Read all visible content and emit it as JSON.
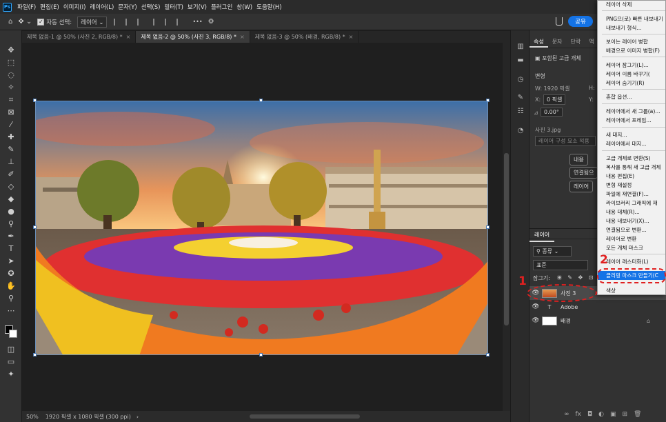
{
  "menubar": {
    "logo": "Ps",
    "items": [
      "파일(F)",
      "편집(E)",
      "이미지(I)",
      "레이어(L)",
      "문자(Y)",
      "선택(S)",
      "필터(T)",
      "보기(V)",
      "플러그인",
      "창(W)",
      "도움말(H)"
    ]
  },
  "options": {
    "auto_select_label": "자동 선택:",
    "auto_select_value": "레이어",
    "more": "•••",
    "share": "공유"
  },
  "tabs": [
    {
      "label": "제목 없음-1 @ 50% (사진 2, RGB/8) *",
      "active": false
    },
    {
      "label": "제목 없음-2 @ 50% (사진 3, RGB/8) *",
      "active": true
    },
    {
      "label": "제목 없음-3 @ 50% (배경, RGB/8) *",
      "active": false
    }
  ],
  "tab_close": "×",
  "status": {
    "zoom": "50%",
    "info": "1920 픽셀 x 1080 픽셀 (300 ppi)",
    "arrow": "›"
  },
  "properties": {
    "tabs": [
      "속성",
      "문자",
      "단락",
      "액"
    ],
    "smart_object": "포함된 고급 개체",
    "transform_label": "변형",
    "w": "W:  1920 픽셀",
    "h": "H:",
    "x": "0 픽셀",
    "x_label": "X:",
    "y": "Y:",
    "angle": "0.00°",
    "file": "사진 3.jpg",
    "layer_comp": "레이어 구성 요소 적용",
    "btn1": "내용",
    "btn2": "연결됨으",
    "btn3": "레이어"
  },
  "layers": {
    "panel_title": "레이어",
    "filter": "종류",
    "blend": "표준",
    "lock_label": "잠그기:",
    "rows": [
      {
        "name": "사진 3",
        "type": "smart",
        "selected": true
      },
      {
        "name": "Adobe",
        "type": "text",
        "selected": false
      },
      {
        "name": "배경",
        "type": "background",
        "selected": false
      }
    ],
    "footer": [
      "∞",
      "fx",
      "◘",
      "◐",
      "▣",
      "⊞",
      "🗑"
    ]
  },
  "context_menu": {
    "items": [
      {
        "label": "레이어 삭제",
        "sep_after": true
      },
      {
        "label": "PNG으(로) 빠른 내보내기",
        "sep_after": false
      },
      {
        "label": "내보내기 형식...",
        "sep_after": true
      },
      {
        "label": "보이는 레이어 병합",
        "sep_after": false
      },
      {
        "label": "배경으로 이미지 병합(F)",
        "sep_after": true
      },
      {
        "label": "레이어 잠그기(L)...",
        "sep_after": false
      },
      {
        "label": "레이어 이름 바꾸기(",
        "sep_after": false
      },
      {
        "label": "레이어 숨기기(R)",
        "sep_after": true
      },
      {
        "label": "혼합 옵션...",
        "sep_after": true
      },
      {
        "label": "레이어에서 새 그룹(a)...",
        "sep_after": false
      },
      {
        "label": "레이어에서 프레임...",
        "sep_after": true
      },
      {
        "label": "새 대지...",
        "sep_after": false
      },
      {
        "label": "레이어에서 대지...",
        "sep_after": true
      },
      {
        "label": "고급 개체로 변환(S)",
        "sep_after": false
      },
      {
        "label": "복사를 통해 새 고급 개체",
        "sep_after": false
      },
      {
        "label": "내용 편집(E)",
        "sep_after": false
      },
      {
        "label": "변형 재설정",
        "sep_after": false
      },
      {
        "label": "파일에 재연결(F)...",
        "sep_after": false
      },
      {
        "label": "라이브러리 그래픽에 재",
        "sep_after": false
      },
      {
        "label": "내용 대체(R)...",
        "sep_after": false
      },
      {
        "label": "내용 내보내기(X)...",
        "sep_after": false
      },
      {
        "label": "연결됨으로 변환...",
        "sep_after": false
      },
      {
        "label": "레이어로 변환",
        "sep_after": false
      },
      {
        "label": "모든 개체 마스크",
        "sep_after": true
      },
      {
        "label": "레이어 래스터화(L)",
        "sep_after": false
      },
      {
        "label": "클리핑 마스크 만들기(C",
        "sep_after": false,
        "highlight": true
      },
      {
        "label": "색상",
        "sep_after": false
      }
    ]
  },
  "annotations": {
    "step1": "1",
    "step2": "2"
  },
  "colors": {
    "accent": "#1473e6",
    "annotation": "#e02020"
  }
}
